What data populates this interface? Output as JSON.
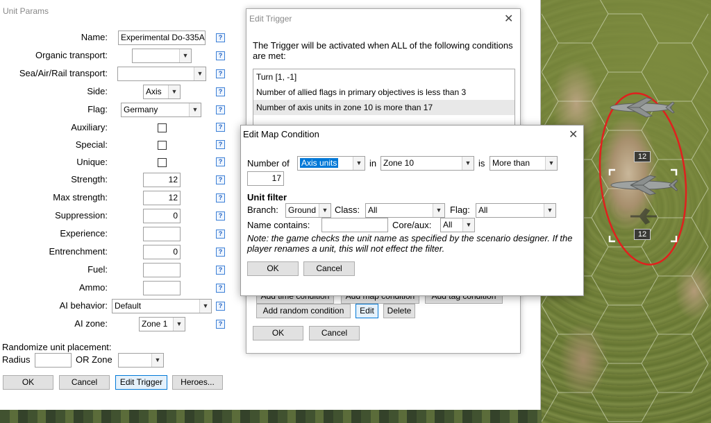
{
  "unit_params": {
    "title": "Unit Params",
    "fields": {
      "name": {
        "label": "Name:",
        "value": "Experimental Do-335A"
      },
      "organic_transport": {
        "label": "Organic transport:",
        "value": ""
      },
      "sea_air_rail": {
        "label": "Sea/Air/Rail transport:",
        "value": ""
      },
      "side": {
        "label": "Side:",
        "value": "Axis"
      },
      "flag": {
        "label": "Flag:",
        "value": "Germany"
      },
      "auxiliary": {
        "label": "Auxiliary:",
        "checked": false
      },
      "special": {
        "label": "Special:",
        "checked": false
      },
      "unique": {
        "label": "Unique:",
        "checked": false
      },
      "strength": {
        "label": "Strength:",
        "value": "12"
      },
      "max_strength": {
        "label": "Max strength:",
        "value": "12"
      },
      "suppression": {
        "label": "Suppression:",
        "value": "0"
      },
      "experience": {
        "label": "Experience:",
        "value": ""
      },
      "entrenchment": {
        "label": "Entrenchment:",
        "value": "0"
      },
      "fuel": {
        "label": "Fuel:",
        "value": ""
      },
      "ammo": {
        "label": "Ammo:",
        "value": ""
      },
      "ai_behavior": {
        "label": "AI behavior:",
        "value": "Default"
      },
      "ai_zone": {
        "label": "AI zone:",
        "value": "Zone 1"
      }
    },
    "help_glyph": "?",
    "randomize": {
      "label": "Randomize unit placement:",
      "radius_label": "Radius",
      "radius_value": "",
      "or_zone_label": "OR Zone",
      "zone_value": ""
    },
    "buttons": {
      "ok": "OK",
      "cancel": "Cancel",
      "edit_trigger": "Edit Trigger",
      "heroes": "Heroes..."
    }
  },
  "edit_trigger": {
    "title": "Edit Trigger",
    "close": "✕",
    "description": "The Trigger will be activated when ALL of the following conditions are met:",
    "conditions": [
      "Turn [1, -1]",
      "Number of allied flags in primary objectives is less than 3",
      "Number of axis units in zone 10 is more than 17"
    ],
    "buttons_hidden_row": [
      "Add time condition",
      "Add map condition",
      "Add tag condition"
    ],
    "buttons_row2": {
      "add_random": "Add random condition",
      "edit": "Edit",
      "delete": "Delete"
    },
    "ok": "OK",
    "cancel": "Cancel"
  },
  "edit_map_condition": {
    "title": "Edit Map Condition",
    "close": "✕",
    "number_of_label": "Number of",
    "subject": "Axis units",
    "in_label": "in",
    "zone": "Zone 10",
    "is_label": "is",
    "comparison": "More than",
    "count": "17",
    "unit_filter_heading": "Unit filter",
    "branch_label": "Branch:",
    "branch": "Ground",
    "class_label": "Class:",
    "class": "All",
    "flag_label": "Flag:",
    "flag": "All",
    "name_contains_label": "Name contains:",
    "name_contains": "",
    "coreaux_label": "Core/aux:",
    "coreaux": "All",
    "note": "Note: the game checks the unit name as specified by the scenario designer. If the player renames a unit, this will not effect the filter.",
    "ok": "OK",
    "cancel": "Cancel"
  },
  "map": {
    "unit_strength_top": "12",
    "unit_strength_bottom": "12",
    "highlight_color": "#e0201e"
  }
}
